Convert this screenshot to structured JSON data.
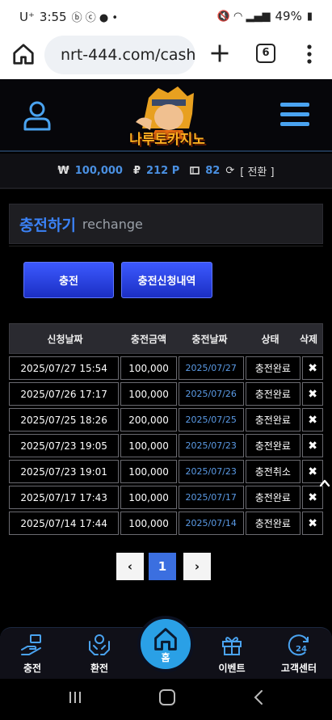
{
  "status": {
    "carrier": "U⁺",
    "time": "3:55",
    "battery": "49%"
  },
  "browser": {
    "url": "nrt-444.com/cash",
    "tab_count": "6"
  },
  "site": {
    "logo_text": "나루토카지노"
  },
  "balance": {
    "cash_symbol": "₩",
    "cash": "100,000",
    "point_symbol": "₽",
    "points": "212 P",
    "coupon": "82",
    "convert_label": "[ 전환 ]"
  },
  "page": {
    "title": "충전하기",
    "subtitle": "rechange"
  },
  "actions": {
    "charge_label": "충전",
    "history_label": "충전신청내역"
  },
  "table": {
    "headers": [
      "신청날짜",
      "충전금액",
      "충전날짜",
      "상태",
      "삭제"
    ],
    "rows": [
      {
        "requested": "2025/07/27 15:54",
        "amount": "100,000",
        "charged": "2025/07/27",
        "status": "충전완료"
      },
      {
        "requested": "2025/07/26 17:17",
        "amount": "100,000",
        "charged": "2025/07/26",
        "status": "충전완료"
      },
      {
        "requested": "2025/07/25 18:26",
        "amount": "200,000",
        "charged": "2025/07/25",
        "status": "충전완료"
      },
      {
        "requested": "2025/07/23 19:05",
        "amount": "100,000",
        "charged": "2025/07/23",
        "status": "충전완료"
      },
      {
        "requested": "2025/07/23 19:01",
        "amount": "100,000",
        "charged": "2025/07/23",
        "status": "충전취소"
      },
      {
        "requested": "2025/07/17 17:43",
        "amount": "100,000",
        "charged": "2025/07/17",
        "status": "충전완료"
      },
      {
        "requested": "2025/07/14 17:44",
        "amount": "100,000",
        "charged": "2025/07/14",
        "status": "충전완료"
      }
    ],
    "delete_glyph": "✖"
  },
  "pagination": {
    "prev": "‹",
    "current": "1",
    "next": "›"
  },
  "bottom_nav": {
    "items": [
      {
        "label": "충전",
        "icon": "deposit-hand-icon"
      },
      {
        "label": "환전",
        "icon": "exchange-hands-icon"
      },
      {
        "label": "홈",
        "icon": "home-icon"
      },
      {
        "label": "이벤트",
        "icon": "gift-icon"
      },
      {
        "label": "고객센터",
        "icon": "support-24-icon"
      }
    ]
  },
  "colors": {
    "accent_blue": "#3b82f6",
    "button_blue": "#2a44e0",
    "home_circle": "#2aa0e6",
    "balance_blue": "#4a90e2"
  }
}
